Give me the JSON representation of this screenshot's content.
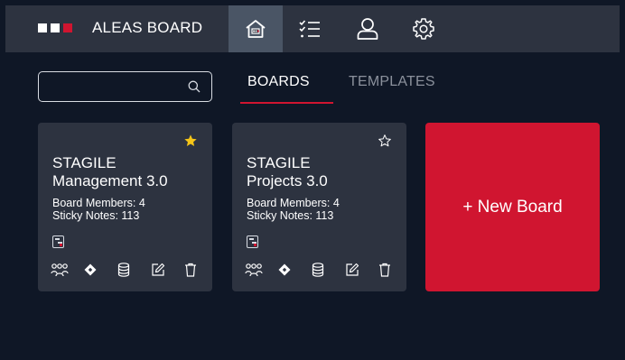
{
  "app": {
    "name": "ALEAS BOARD",
    "logo_colors": [
      "#ffffff",
      "#ffffff",
      "#d01530"
    ]
  },
  "nav": {
    "items": [
      {
        "icon": "home-icon",
        "active": true
      },
      {
        "icon": "checklist-icon",
        "active": false
      },
      {
        "icon": "user-icon",
        "active": false
      },
      {
        "icon": "settings-gear-icon",
        "active": false
      }
    ]
  },
  "search": {
    "value": "",
    "placeholder": "",
    "icon": "search-icon"
  },
  "tabs": [
    {
      "label": "BOARDS",
      "active": true
    },
    {
      "label": "TEMPLATES",
      "active": false
    }
  ],
  "boards": [
    {
      "title_line1": "STAGILE",
      "title_line2": "Management 3.0",
      "members_text": "Board Members: 4",
      "notes_text": "Sticky Notes: 113",
      "favorite": true
    },
    {
      "title_line1": "STAGILE",
      "title_line2": "Projects 3.0",
      "members_text": "Board Members: 4",
      "notes_text": "Sticky Notes: 113",
      "favorite": false
    }
  ],
  "card_actions": [
    "members-icon",
    "jira-diamond-icon",
    "database-icon",
    "edit-icon",
    "trash-icon"
  ],
  "new_board": {
    "label": "+ New Board"
  },
  "colors": {
    "accent": "#d01530",
    "topbar": "#2d3340",
    "background": "#0f1726",
    "card": "#2d3340",
    "star_filled": "#f5c518",
    "tab_inactive": "#8b919c"
  }
}
